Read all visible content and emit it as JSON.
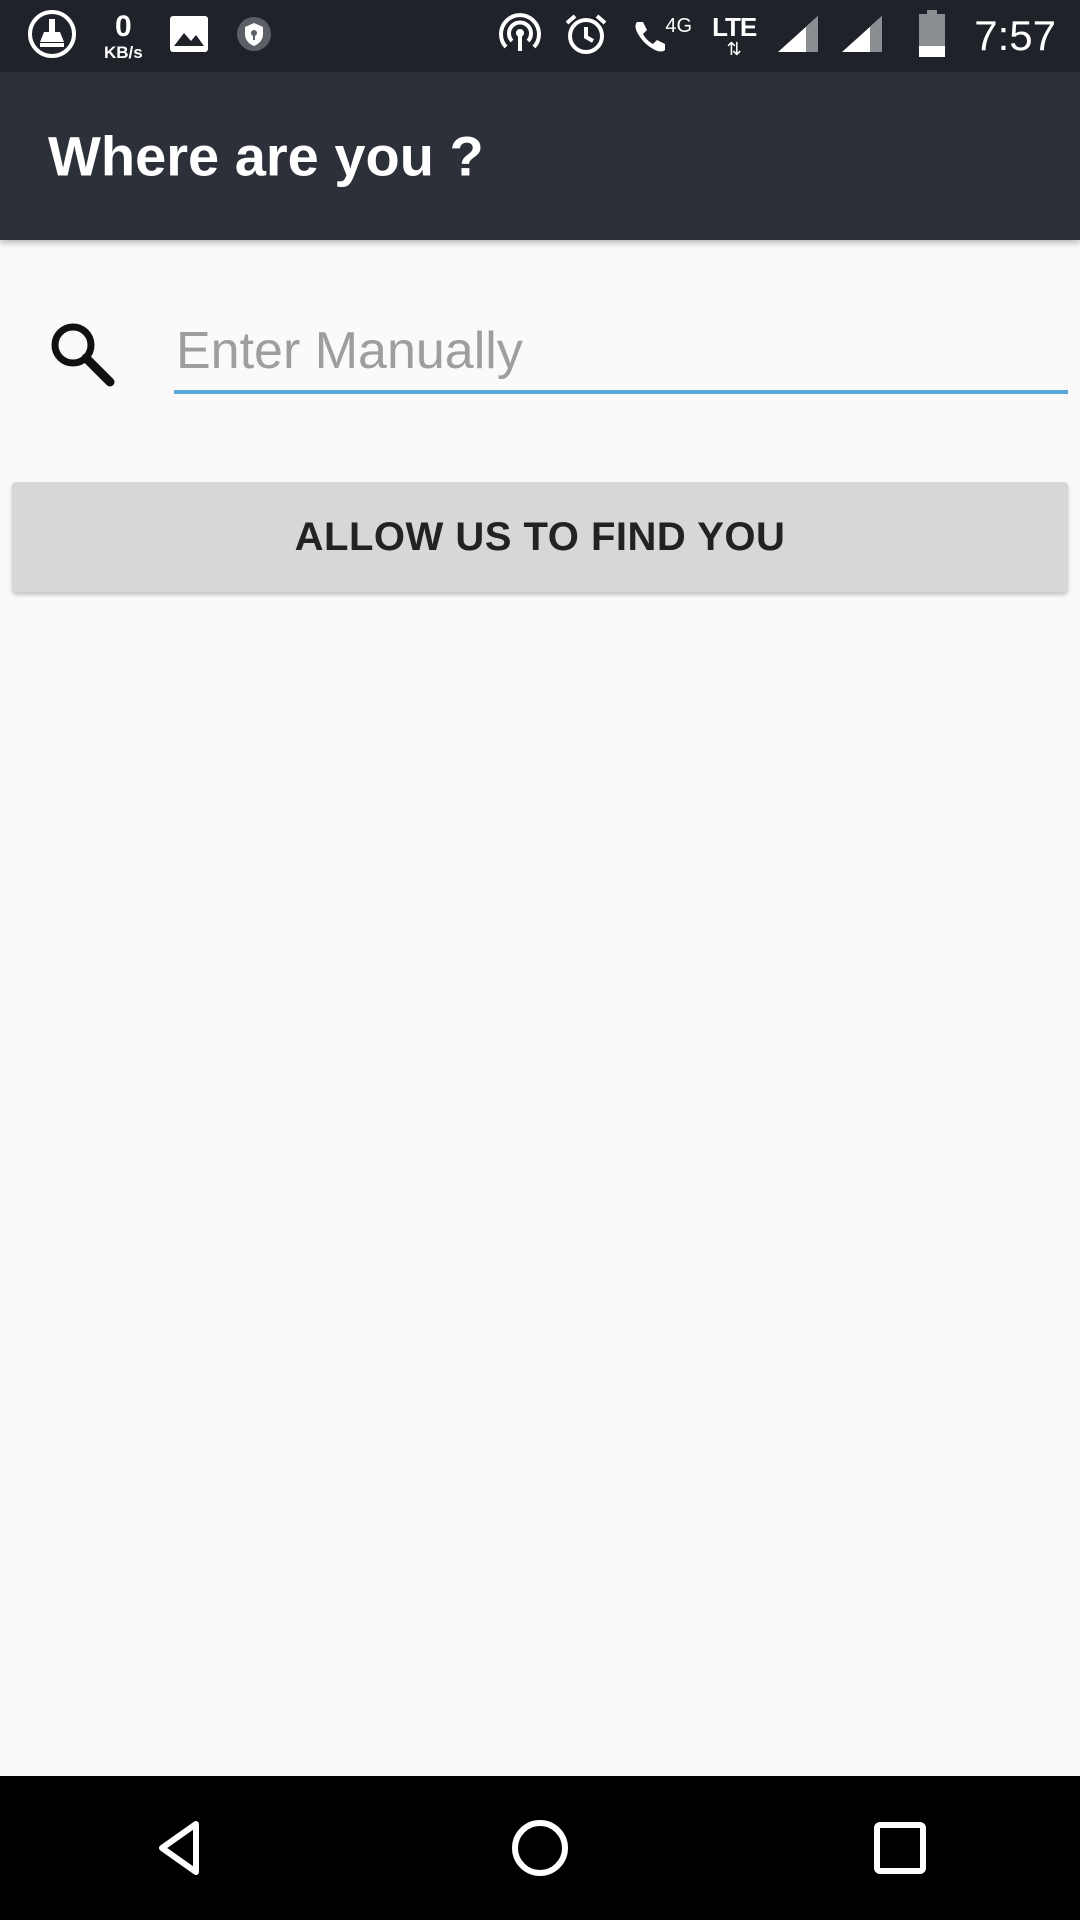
{
  "status_bar": {
    "net_speed_value": "0",
    "net_speed_unit": "KB/s",
    "network_type": "4G",
    "lte_label": "LTE",
    "lte_arrows": "⇅",
    "time": "7:57",
    "icons": [
      "cleaner-icon",
      "image-icon",
      "shield-icon",
      "hotspot-icon",
      "alarm-icon",
      "wifi-call-icon",
      "signal-icon",
      "signal-icon",
      "battery-icon"
    ]
  },
  "app_bar": {
    "title": "Where are you ?"
  },
  "search": {
    "placeholder": "Enter Manually",
    "value": ""
  },
  "actions": {
    "find_button_label": "ALLOW US TO FIND YOU"
  },
  "nav_bar": {
    "icons": [
      "back-icon",
      "home-icon",
      "recents-icon"
    ]
  }
}
